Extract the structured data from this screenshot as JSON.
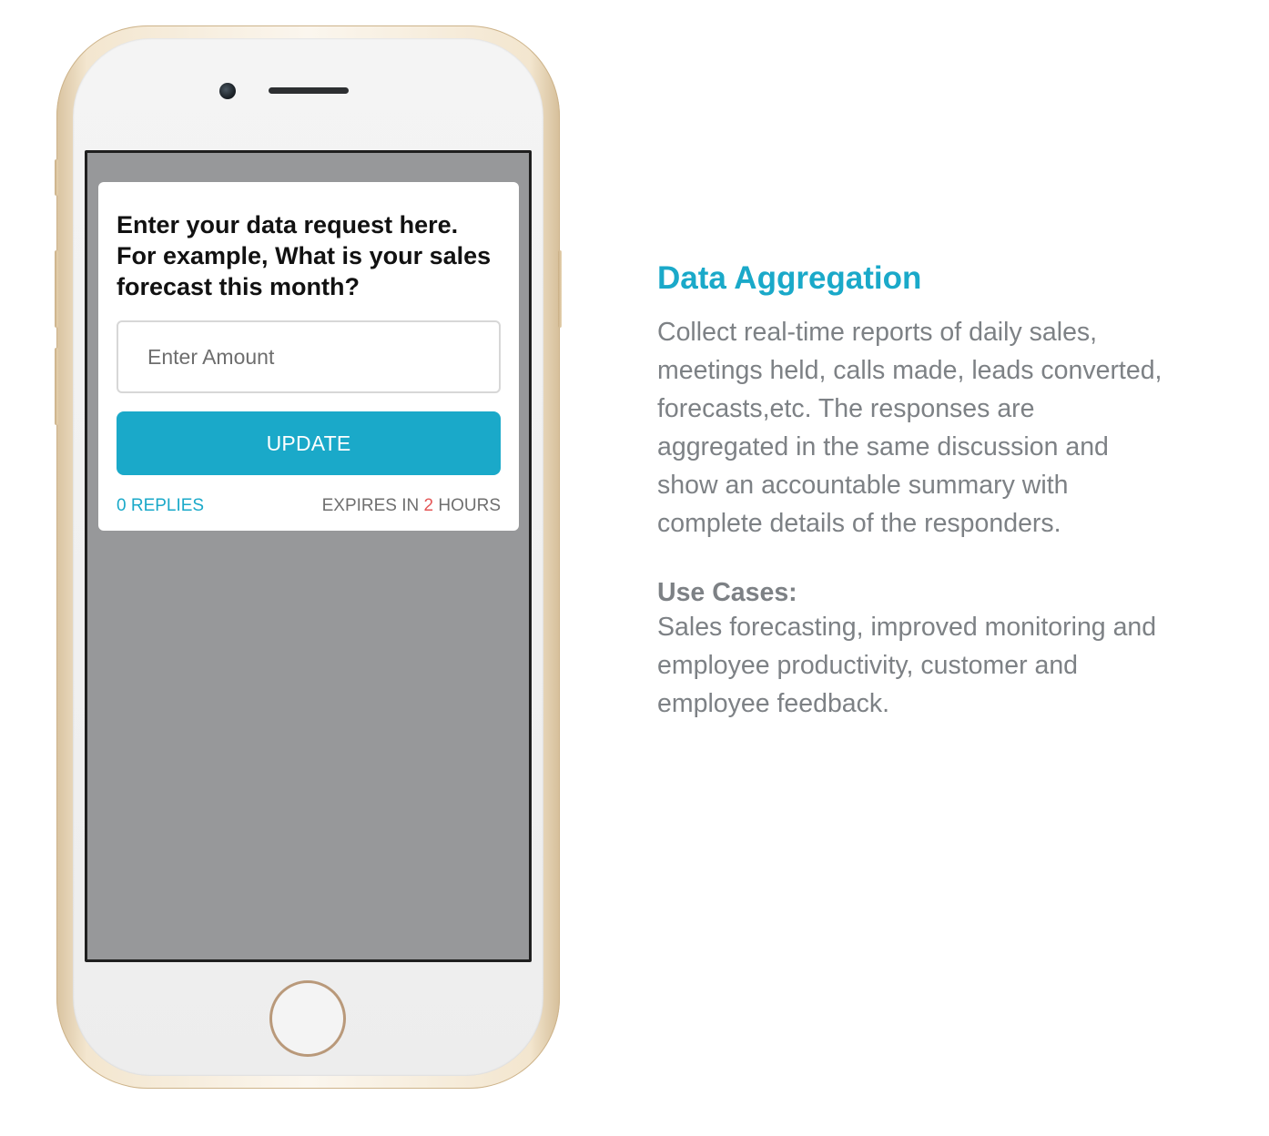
{
  "phone": {
    "card": {
      "question": "Enter your data request here. For example, What is your sales forecast this month?",
      "amount_placeholder": "Enter Amount",
      "update_label": "UPDATE",
      "replies_label": "0 REPLIES",
      "expires_prefix": "EXPIRES IN ",
      "expires_value": "2",
      "expires_suffix": " HOURS"
    },
    "icons": {
      "camera": "front-camera-icon",
      "speaker": "earpiece-speaker-icon",
      "home": "home-button-icon"
    }
  },
  "content": {
    "title": "Data Aggregation",
    "description": "Collect real-time reports of daily sales, meetings held, calls made, leads converted, forecasts,etc. The responses are aggregated in the same discussion and show an accountable summary with complete details of the responders.",
    "use_cases_heading": "Use Cases:",
    "use_cases_text": "Sales forecasting, improved monitoring and employee productivity, customer and employee feedback."
  },
  "colors": {
    "accent": "#1aa9c9",
    "expires_highlight": "#e45757",
    "body_text": "#7d8185",
    "screen_background": "#97989a"
  }
}
